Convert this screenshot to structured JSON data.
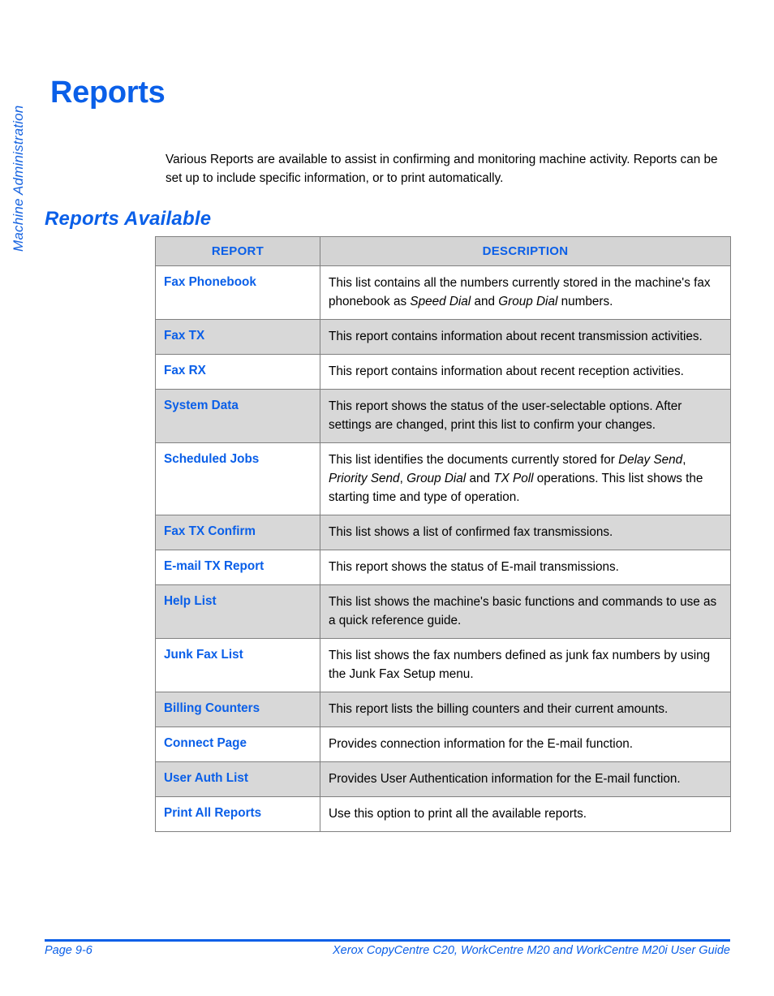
{
  "side_tab": {
    "label": "Machine Administration"
  },
  "page_title": "Reports",
  "intro_paragraph": "Various Reports are available to assist in confirming and monitoring machine activity. Reports can be set up to include specific information, or to print automatically.",
  "section_heading": "Reports Available",
  "table": {
    "headers": {
      "report": "REPORT",
      "description": "DESCRIPTION"
    },
    "rows": [
      {
        "report": "Fax Phonebook",
        "description_html": "This list contains all the numbers currently stored in the machine's fax phonebook as <em>Speed Dial</em> and <em>Group Dial</em> numbers.",
        "description_text": "This list contains all the numbers currently stored in the machine's fax phonebook as Speed Dial and Group Dial numbers.",
        "shaded": false
      },
      {
        "report": "Fax TX",
        "description_html": "This report contains information about recent transmission activities.",
        "description_text": "This report contains information about recent transmission activities.",
        "shaded": true
      },
      {
        "report": "Fax RX",
        "description_html": "This report contains information about recent reception activities.",
        "description_text": "This report contains information about recent reception activities.",
        "shaded": false
      },
      {
        "report": "System Data",
        "description_html": "This report shows the status of the user-selectable options. After settings are changed, print this list to confirm your changes.",
        "description_text": "This report shows the status of the user-selectable options. After settings are changed, print this list to confirm your changes.",
        "shaded": true
      },
      {
        "report": "Scheduled Jobs",
        "description_html": "This list identifies the documents currently stored for <em>Delay Send</em>, <em>Priority Send</em>, <em>Group Dial</em> and <em>TX Poll</em> operations. This list shows the starting time and type of operation.",
        "description_text": "This list identifies the documents currently stored for Delay Send, Priority Send, Group Dial and TX Poll operations. This list shows the starting time and type of operation.",
        "shaded": false
      },
      {
        "report": "Fax TX Confirm",
        "description_html": "This list shows a list of confirmed fax transmissions.",
        "description_text": "This list shows a list of confirmed fax transmissions.",
        "shaded": true
      },
      {
        "report": "E-mail TX Report",
        "description_html": "This report shows the status of E-mail transmissions.",
        "description_text": "This report shows the status of E-mail transmissions.",
        "shaded": false
      },
      {
        "report": "Help List",
        "description_html": "This list shows the machine's basic functions and commands to use as a quick reference guide.",
        "description_text": "This list shows the machine's basic functions and commands to use as a quick reference guide.",
        "shaded": true
      },
      {
        "report": "Junk Fax List",
        "description_html": "This list shows the fax numbers defined as junk fax numbers by using the Junk Fax Setup menu.",
        "description_text": "This list shows the fax numbers defined as junk fax numbers by using the Junk Fax Setup menu.",
        "shaded": false
      },
      {
        "report": "Billing Counters",
        "description_html": "This report lists the billing counters and their current amounts.",
        "description_text": "This report lists the billing counters and their current amounts.",
        "shaded": true
      },
      {
        "report": "Connect Page",
        "description_html": "Provides connection information for the E-mail function.",
        "description_text": "Provides connection information for the E-mail function.",
        "shaded": false
      },
      {
        "report": "User Auth List",
        "description_html": "Provides User Authentication information for the E-mail function.",
        "description_text": "Provides User Authentication information for the E-mail function.",
        "shaded": true
      },
      {
        "report": "Print All Reports",
        "description_html": "Use this option to print all the available reports.",
        "description_text": "Use this option to print all the available reports.",
        "shaded": false
      }
    ]
  },
  "footer": {
    "page_number": "Page 9-6",
    "guide_title": "Xerox CopyCentre C20, WorkCentre M20 and WorkCentre M20i User Guide"
  },
  "colors": {
    "accent_blue": "#0A5FE8",
    "table_header_gray": "#d4d4d4",
    "table_row_gray": "#d8d8d8",
    "border_gray": "#808080",
    "text_black": "#000000"
  }
}
